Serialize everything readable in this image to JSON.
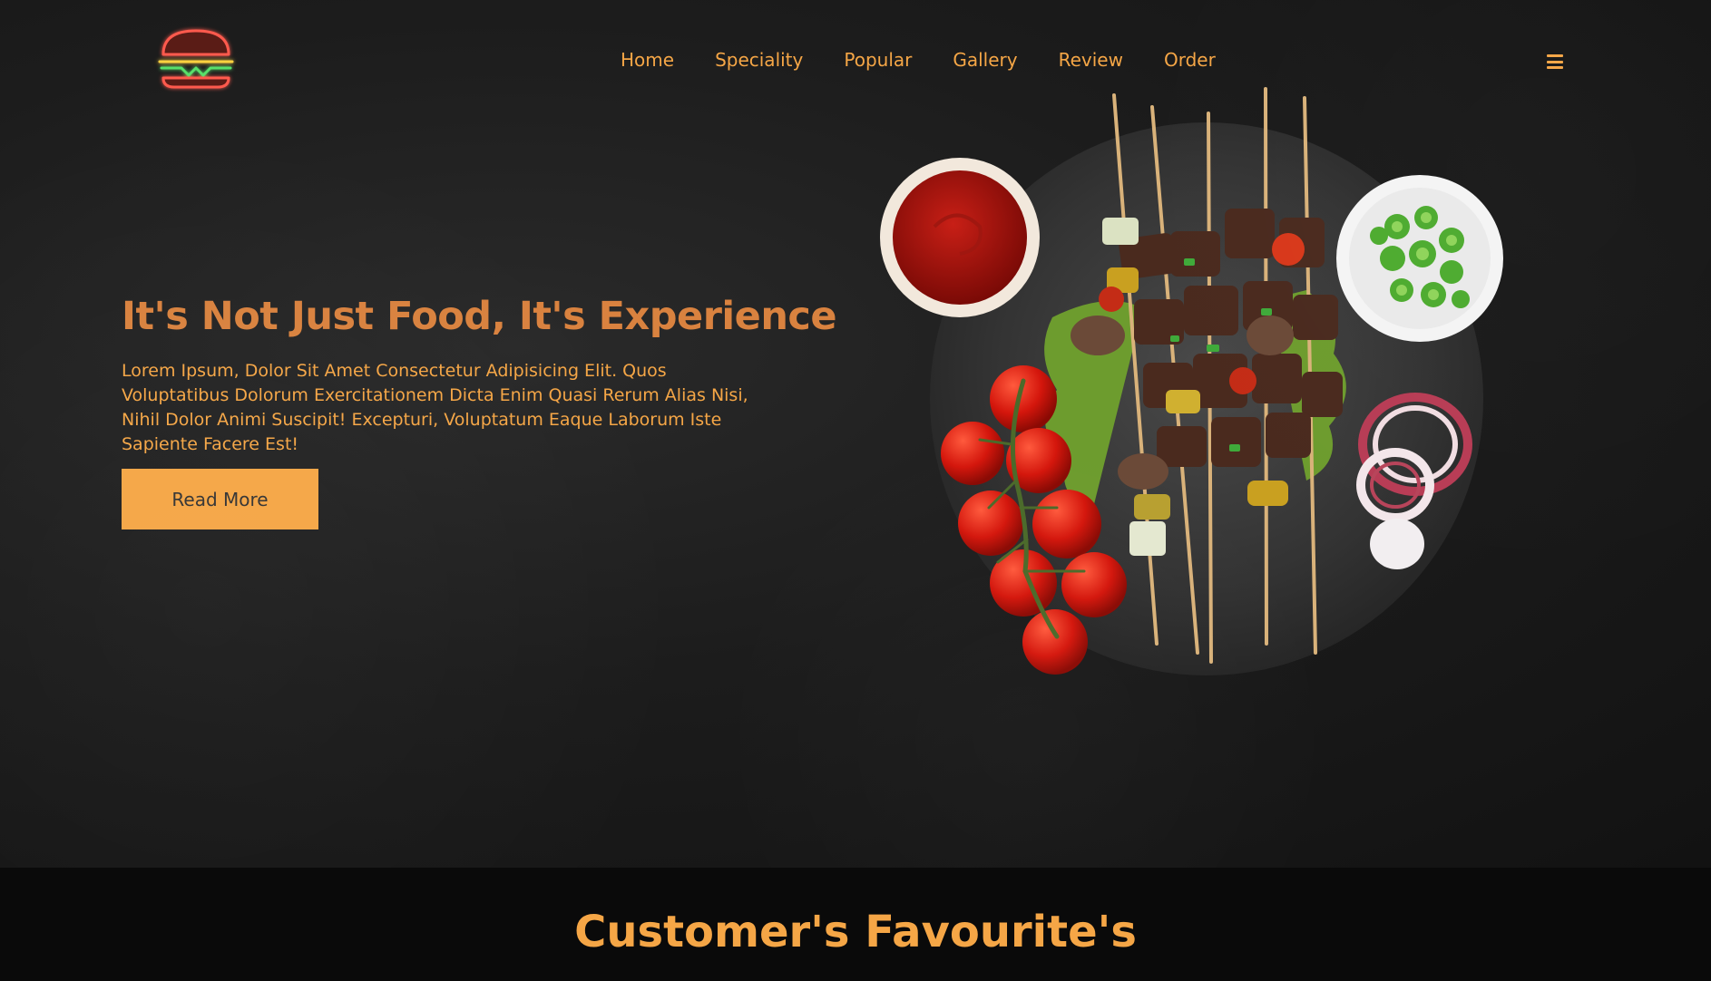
{
  "nav": {
    "items": [
      "Home",
      "Speciality",
      "Popular",
      "Gallery",
      "Review",
      "Order"
    ]
  },
  "icons": {
    "logo": "burger-logo-icon",
    "menu": "hamburger-menu-icon"
  },
  "hero": {
    "title": "It's Not Just Food, It's Experience",
    "description": "Lorem Ipsum, Dolor Sit Amet Consectetur Adipisicing Elit. Quos Voluptatibus Dolorum Exercitationem Dicta Enim Quasi Rerum Alias Nisi, Nihil Dolor Animi Suscipit! Excepturi, Voluptatum Eaque Laborum Iste Sapiente Facere Est!",
    "button": "Read More"
  },
  "section": {
    "title": "Customer's Favourite's"
  },
  "colors": {
    "accent": "#f5a646",
    "title": "#d9823f",
    "background": "#1c1c1c"
  }
}
